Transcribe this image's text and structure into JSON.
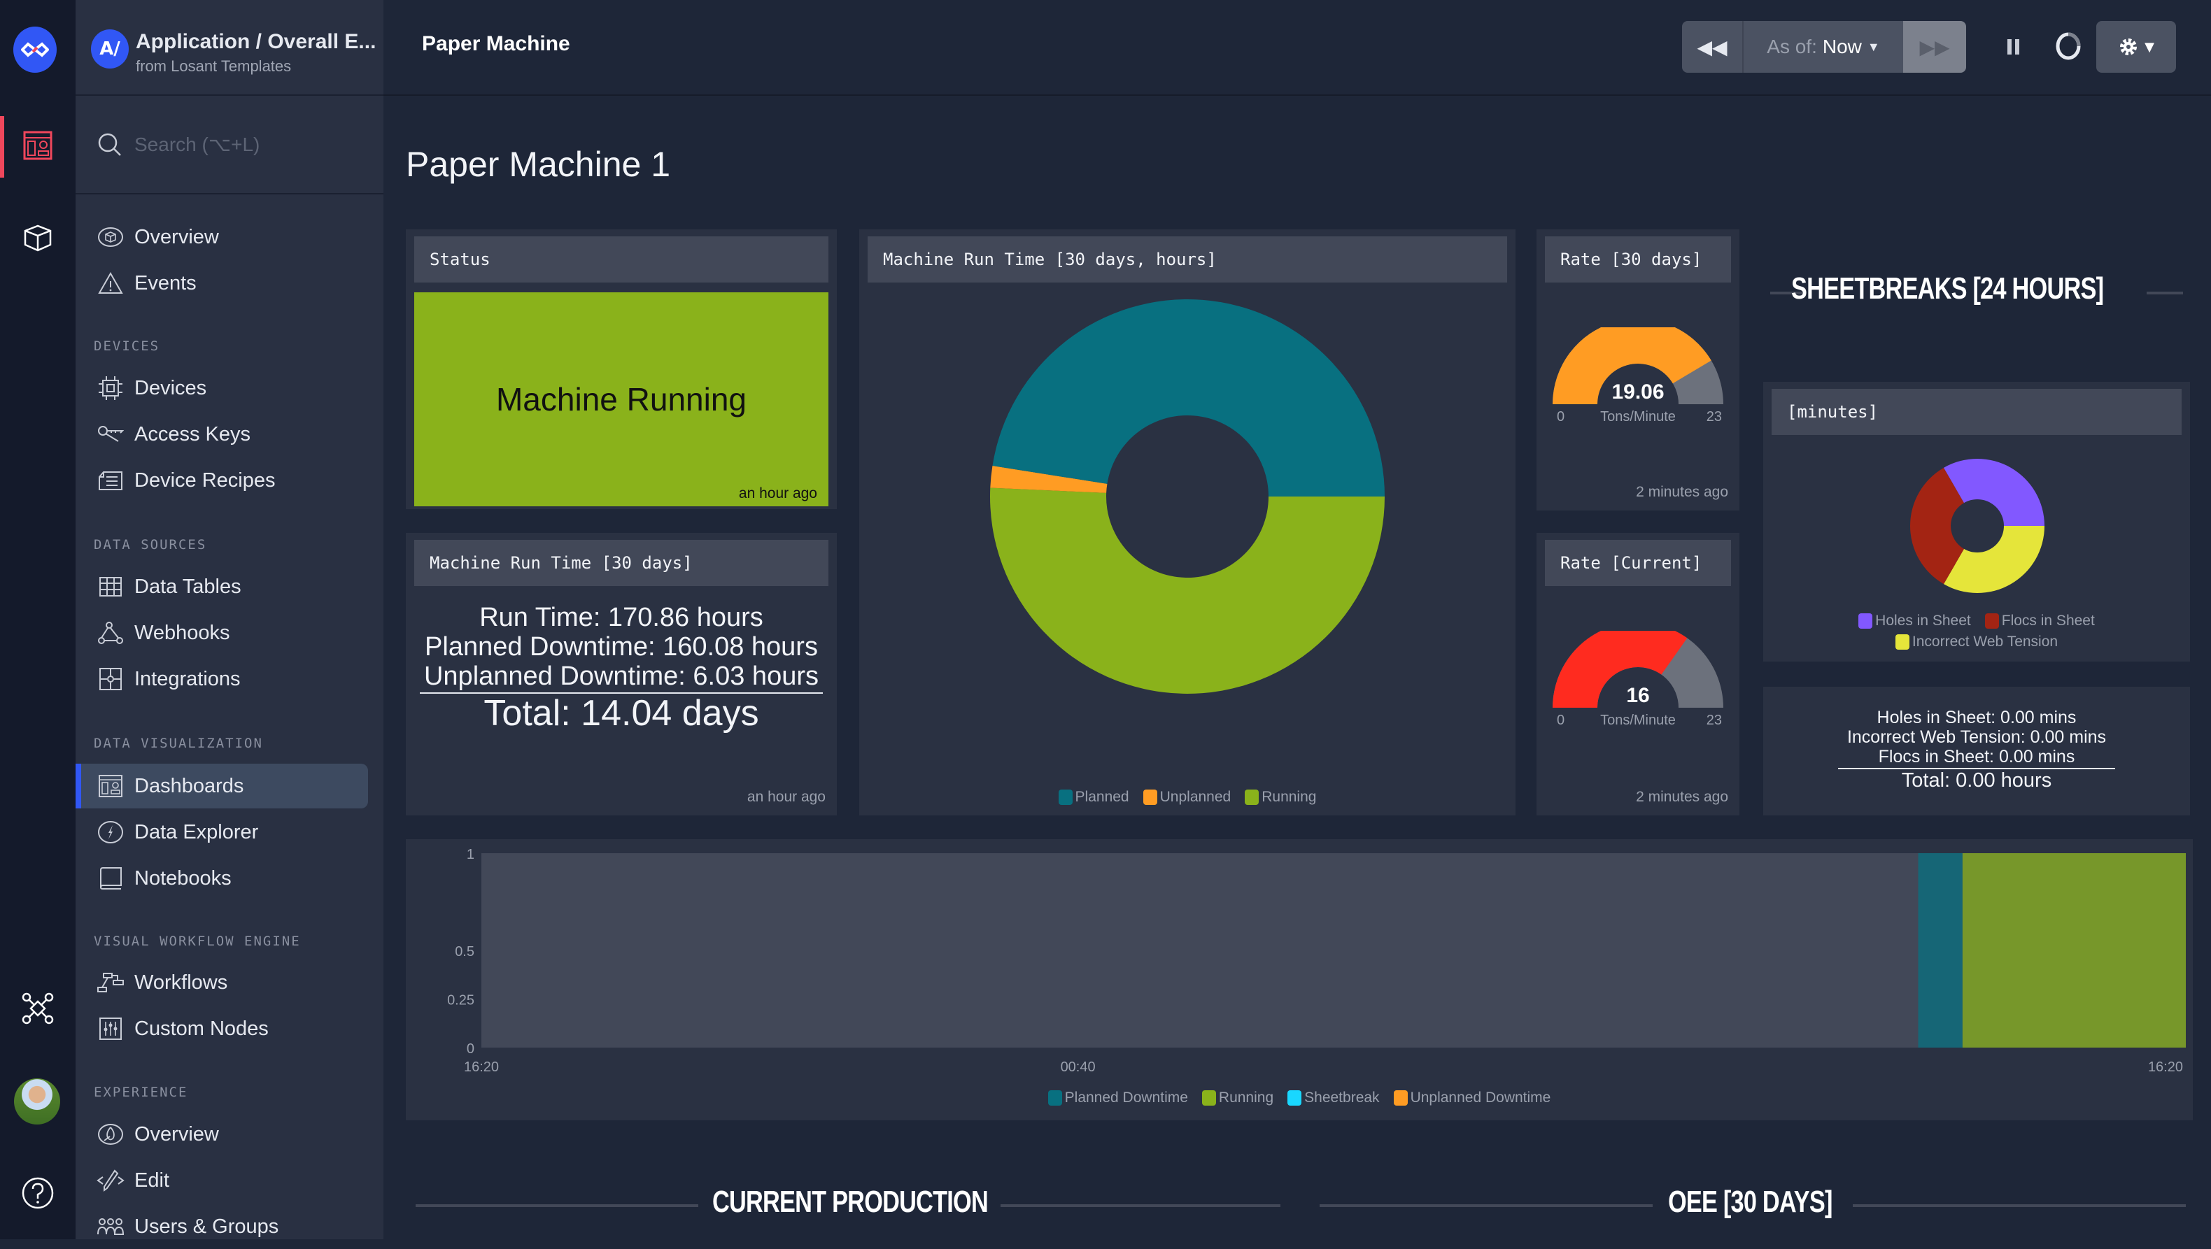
{
  "app": {
    "badge": "A/",
    "title": "Application / Overall E...",
    "subtitle": "from Losant Templates"
  },
  "search": {
    "placeholder": "Search (⌥+L)"
  },
  "rail": {
    "icons": [
      "losant-logo-icon",
      "dashboard-icon",
      "cube-icon",
      "workflow-network-icon",
      "user-avatar",
      "help-icon"
    ]
  },
  "sidebar": {
    "top_items": [
      {
        "label": "Overview",
        "icon": "cube-circle-icon"
      },
      {
        "label": "Events",
        "icon": "warning-triangle-icon"
      }
    ],
    "sections": [
      {
        "title": "DEVICES",
        "items": [
          {
            "label": "Devices",
            "icon": "chip-icon"
          },
          {
            "label": "Access Keys",
            "icon": "keys-icon"
          },
          {
            "label": "Device Recipes",
            "icon": "recipe-icon"
          }
        ]
      },
      {
        "title": "DATA SOURCES",
        "items": [
          {
            "label": "Data Tables",
            "icon": "table-icon"
          },
          {
            "label": "Webhooks",
            "icon": "webhook-icon"
          },
          {
            "label": "Integrations",
            "icon": "puzzle-icon"
          }
        ]
      },
      {
        "title": "DATA VISUALIZATION",
        "items": [
          {
            "label": "Dashboards",
            "icon": "dashboard-icon",
            "active": true
          },
          {
            "label": "Data Explorer",
            "icon": "compass-icon"
          },
          {
            "label": "Notebooks",
            "icon": "notebook-icon"
          }
        ]
      },
      {
        "title": "VISUAL WORKFLOW ENGINE",
        "items": [
          {
            "label": "Workflows",
            "icon": "workflow-icon"
          },
          {
            "label": "Custom Nodes",
            "icon": "sliders-icon"
          }
        ]
      },
      {
        "title": "EXPERIENCE",
        "items": [
          {
            "label": "Overview",
            "icon": "experience-icon"
          },
          {
            "label": "Edit",
            "icon": "code-edit-icon"
          },
          {
            "label": "Users & Groups",
            "icon": "users-icon"
          }
        ]
      }
    ]
  },
  "topbar": {
    "dashboard_name": "Paper Machine",
    "as_of_label": "As of:",
    "as_of_value": "Now"
  },
  "page": {
    "title": "Paper Machine 1"
  },
  "colors": {
    "accent": "#3157f5",
    "running": "#8ab21b",
    "planned": "#087080",
    "unplanned": "#ff9c23",
    "sheetbreak": "#19d7ff",
    "gauge_orange": "#ff9c23",
    "gauge_red": "#ff2b1f",
    "holes": "#8258ff",
    "flocs": "#a32413",
    "tension": "#e5e53a"
  },
  "widgets": {
    "status": {
      "title": "Status",
      "value": "Machine Running",
      "updated": "an hour ago"
    },
    "run_time_text": {
      "title": "Machine Run Time [30 days]",
      "lines": [
        "Run Time: 170.86 hours",
        "Planned Downtime: 160.08 hours",
        "Unplanned Downtime: 6.03 hours"
      ],
      "total": "Total: 14.04 days",
      "updated": "an hour ago"
    },
    "rate_30": {
      "title": "Rate [30 days]",
      "value": "19.06",
      "unit": "Tons/Minute",
      "min": "0",
      "max": "23",
      "updated": "2 minutes ago"
    },
    "rate_current": {
      "title": "Rate [Current]",
      "value": "16",
      "unit": "Tons/Minute",
      "min": "0",
      "max": "23",
      "updated": "2 minutes ago"
    },
    "sheetbreaks_header": "SHEETBREAKS [24 HOURS]",
    "sheetbreaks_pie_title": "[minutes]",
    "sheetbreaks_text": {
      "lines": [
        "Holes in Sheet: 0.00 mins",
        "Incorrect Web Tension: 0.00 mins",
        "Flocs in Sheet: 0.00 mins"
      ],
      "total": "Total: 0.00 hours"
    },
    "run_time_pie_title": "Machine Run Time [30 days, hours]"
  },
  "sections_bottom": [
    "CURRENT PRODUCTION",
    "OEE [30 DAYS]"
  ],
  "chart_data": [
    {
      "type": "pie",
      "title": "Machine Run Time [30 days, hours]",
      "donut": true,
      "slices": [
        {
          "label": "Planned",
          "value": 160.08,
          "color": "#087080"
        },
        {
          "label": "Unplanned",
          "value": 6.03,
          "color": "#ff9c23"
        },
        {
          "label": "Running",
          "value": 170.86,
          "color": "#8ab21b"
        }
      ],
      "legend": "bottom"
    },
    {
      "type": "gauge",
      "title": "Rate [30 days]",
      "value": 19.06,
      "min": 0,
      "max": 23,
      "unit": "Tons/Minute",
      "color": "#ff9c23"
    },
    {
      "type": "gauge",
      "title": "Rate [Current]",
      "value": 16,
      "min": 0,
      "max": 23,
      "unit": "Tons/Minute",
      "color": "#ff2b1f"
    },
    {
      "type": "pie",
      "title": "[minutes]",
      "donut": true,
      "slices": [
        {
          "label": "Holes in Sheet",
          "value": 1,
          "color": "#8258ff"
        },
        {
          "label": "Flocs in Sheet",
          "value": 1,
          "color": "#a32413"
        },
        {
          "label": "Incorrect Web Tension",
          "value": 1,
          "color": "#e5e53a"
        }
      ],
      "legend": "bottom"
    },
    {
      "type": "area",
      "title": "",
      "x_ticks": [
        "16:20",
        "00:40",
        "16:20"
      ],
      "y_ticks": [
        0,
        0.25,
        0.5,
        1
      ],
      "ylim": [
        0,
        1
      ],
      "x_range_hours": 24,
      "segments": [
        {
          "series": "Planned Downtime",
          "start_frac": 0.843,
          "end_frac": 0.869,
          "value": 1
        },
        {
          "series": "Running",
          "start_frac": 0.869,
          "end_frac": 1.0,
          "value": 1
        }
      ],
      "series": [
        {
          "name": "Planned Downtime",
          "color": "#087080"
        },
        {
          "name": "Running",
          "color": "#8ab21b"
        },
        {
          "name": "Sheetbreak",
          "color": "#19d7ff"
        },
        {
          "name": "Unplanned Downtime",
          "color": "#ff9c23"
        }
      ],
      "legend": "bottom"
    }
  ]
}
